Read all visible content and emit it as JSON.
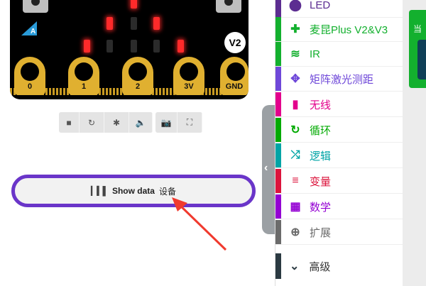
{
  "board": {
    "version_badge": "V2",
    "logo_letter": "A",
    "pins": [
      "0",
      "1",
      "2",
      "3V",
      "GND"
    ]
  },
  "sim_controls": [
    {
      "name": "stop",
      "icon": "■"
    },
    {
      "name": "restart",
      "icon": "↻"
    },
    {
      "name": "debug",
      "icon": "✱"
    },
    {
      "name": "mute",
      "icon": "🔈"
    },
    {
      "name": "screenshot",
      "icon": "📷"
    },
    {
      "name": "fullscreen",
      "icon": "⛶"
    }
  ],
  "show_data": {
    "label": "Show data",
    "device": "设备"
  },
  "toolbox": [
    {
      "label": "LED",
      "color": "#5c2d91",
      "icon": "⬤",
      "key": "led"
    },
    {
      "label": "麦昆Plus V2&V3",
      "color": "#13b02e",
      "icon": "✚",
      "key": "maqueen"
    },
    {
      "label": "IR",
      "color": "#13b02e",
      "icon": "≋",
      "key": "ir"
    },
    {
      "label": "矩阵激光测距",
      "color": "#6f48d9",
      "icon": "✥",
      "key": "laser"
    },
    {
      "label": "无线",
      "color": "#e3008c",
      "icon": "▮",
      "key": "radio"
    },
    {
      "label": "循环",
      "color": "#00aa00",
      "icon": "↻",
      "key": "loops"
    },
    {
      "label": "逻辑",
      "color": "#00a4a6",
      "icon": "⤮",
      "key": "logic"
    },
    {
      "label": "变量",
      "color": "#dc143c",
      "icon": "≡",
      "key": "variables"
    },
    {
      "label": "数学",
      "color": "#9400d3",
      "icon": "▦",
      "key": "math"
    },
    {
      "label": "扩展",
      "color": "#6b6b6b",
      "icon": "⊕",
      "key": "extensions"
    }
  ],
  "advanced": {
    "label": "高级",
    "icon": "⌄"
  },
  "workspace": {
    "block_text": "当"
  }
}
